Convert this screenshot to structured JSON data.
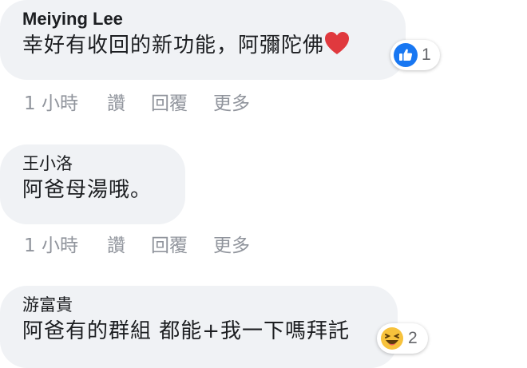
{
  "comments": [
    {
      "author": "Meiying Lee",
      "text": "幸好有收回的新功能，阿彌陀佛",
      "emoji": "heart",
      "reaction": {
        "icon": "like",
        "count": "1"
      },
      "actions": {
        "time": "1 小時",
        "like": "讚",
        "reply": "回覆",
        "more": "更多"
      }
    },
    {
      "author": "王小洛",
      "text": "阿爸母湯哦。",
      "actions": {
        "time": "1 小時",
        "like": "讚",
        "reply": "回覆",
        "more": "更多"
      }
    },
    {
      "author": "游富貴",
      "text": "阿爸有的群組 都能+我一下嗎拜託",
      "reaction": {
        "icon": "haha",
        "count": "2"
      }
    }
  ],
  "colors": {
    "bubble": "#f0f2f5",
    "like_blue": "#1877f2",
    "heart_red": "#e0393e",
    "haha_yellow": "#f7c23c",
    "meta_gray": "#90949c"
  }
}
